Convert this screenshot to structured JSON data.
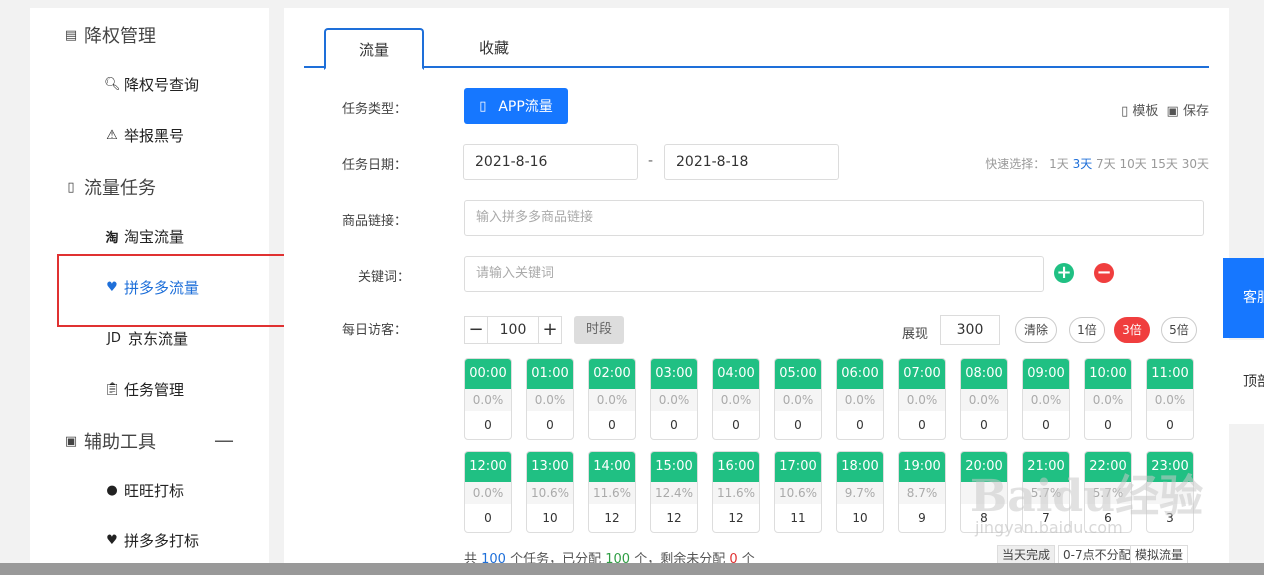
{
  "sidebar": {
    "groups": [
      {
        "label": "降权管理",
        "icon": "list-icon"
      },
      {
        "label": "流量任务",
        "icon": "doc-icon"
      },
      {
        "label": "辅助工具",
        "icon": "toolbox-icon"
      }
    ],
    "items": [
      {
        "label": "降权号查询",
        "icon": "search-icon"
      },
      {
        "label": "举报黑号",
        "icon": "warning-icon"
      },
      {
        "label": "淘宝流量",
        "icon": "taobao-icon",
        "glyph": "淘"
      },
      {
        "label": "拼多多流量",
        "icon": "pinduoduo-icon"
      },
      {
        "label": "京东流量",
        "icon": "jd-icon",
        "glyph": "JD"
      },
      {
        "label": "任务管理",
        "icon": "clipboard-icon"
      },
      {
        "label": "旺旺打标",
        "icon": "wangwang-icon"
      },
      {
        "label": "拼多多打标",
        "icon": "pinduoduo-tag-icon"
      }
    ],
    "collapse_glyph": "—"
  },
  "tabs": [
    {
      "label": "流量"
    },
    {
      "label": "收藏"
    }
  ],
  "form": {
    "task_type_label": "任务类型：",
    "task_type_button": "APP流量",
    "template_link": "模板",
    "save_link": "保存",
    "date_label": "任务日期：",
    "date_start": "2021-8-16",
    "date_sep": "-",
    "date_end": "2021-8-18",
    "quick_label": "快速选择：",
    "quick_options": [
      "1天",
      "3天",
      "7天",
      "10天",
      "15天",
      "30天"
    ],
    "quick_selected": "3天",
    "product_label": "商品链接：",
    "product_placeholder": "输入拼多多商品链接",
    "keyword_label": "关键词：",
    "keyword_placeholder": "请输入关键词",
    "add_glyph": "+",
    "remove_glyph": "−",
    "visitors_label": "每日访客：",
    "visitors_value": "100",
    "minus_glyph": "−",
    "plus_glyph": "+",
    "segment_button": "时段",
    "show_label": "展现",
    "show_value": "300",
    "clear_button": "清除",
    "multipliers": [
      "1倍",
      "3倍",
      "5倍"
    ],
    "multiplier_selected": "3倍"
  },
  "time_slots": [
    {
      "time": "00:00",
      "pct": "0.0%",
      "count": "0"
    },
    {
      "time": "01:00",
      "pct": "0.0%",
      "count": "0"
    },
    {
      "time": "02:00",
      "pct": "0.0%",
      "count": "0"
    },
    {
      "time": "03:00",
      "pct": "0.0%",
      "count": "0"
    },
    {
      "time": "04:00",
      "pct": "0.0%",
      "count": "0"
    },
    {
      "time": "05:00",
      "pct": "0.0%",
      "count": "0"
    },
    {
      "time": "06:00",
      "pct": "0.0%",
      "count": "0"
    },
    {
      "time": "07:00",
      "pct": "0.0%",
      "count": "0"
    },
    {
      "time": "08:00",
      "pct": "0.0%",
      "count": "0"
    },
    {
      "time": "09:00",
      "pct": "0.0%",
      "count": "0"
    },
    {
      "time": "10:00",
      "pct": "0.0%",
      "count": "0"
    },
    {
      "time": "11:00",
      "pct": "0.0%",
      "count": "0"
    },
    {
      "time": "12:00",
      "pct": "0.0%",
      "count": "0"
    },
    {
      "time": "13:00",
      "pct": "10.6%",
      "count": "10"
    },
    {
      "time": "14:00",
      "pct": "11.6%",
      "count": "12"
    },
    {
      "time": "15:00",
      "pct": "12.4%",
      "count": "12"
    },
    {
      "time": "16:00",
      "pct": "11.6%",
      "count": "12"
    },
    {
      "time": "17:00",
      "pct": "10.6%",
      "count": "11"
    },
    {
      "time": "18:00",
      "pct": "9.7%",
      "count": "10"
    },
    {
      "time": "19:00",
      "pct": "8.7%",
      "count": "9"
    },
    {
      "time": "20:00",
      "pct": "",
      "count": "8"
    },
    {
      "time": "21:00",
      "pct": "5.7%",
      "count": "7"
    },
    {
      "time": "22:00",
      "pct": "5.7%",
      "count": "6"
    },
    {
      "time": "23:00",
      "pct": "",
      "count": "3"
    }
  ],
  "summary": {
    "p1": "共 ",
    "total": "100",
    "p2": " 个任务，已分配 ",
    "assigned": "100",
    "p3": " 个，剩余未分配 ",
    "remaining": "0",
    "p4": " 个"
  },
  "bottom_buttons": [
    "当天完成",
    "0-7点不分配",
    "模拟流量"
  ],
  "float": {
    "service": "客服",
    "top": "顶部"
  },
  "watermark": {
    "main": "Baidu经验",
    "sub": "jingyan.baidu.com"
  },
  "colors": {
    "accent": "#1677ff",
    "slot_green": "#20c083",
    "danger": "#f03e3e"
  }
}
